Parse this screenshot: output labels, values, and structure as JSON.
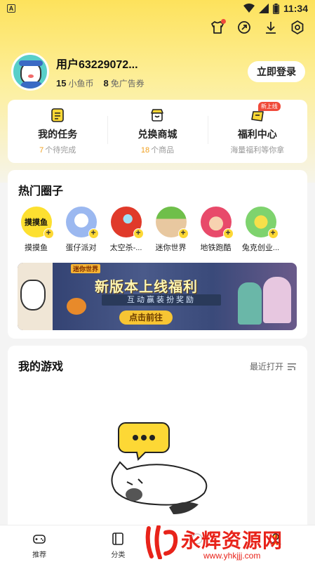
{
  "status_bar": {
    "time": "11:34",
    "app_badge": "A"
  },
  "top_icons": [
    {
      "icon": "shirt-icon"
    },
    {
      "icon": "refresh-icon"
    },
    {
      "icon": "download-icon"
    },
    {
      "icon": "settings-icon"
    }
  ],
  "profile": {
    "username": "用户63229072...",
    "coins_value": "15",
    "coins_label": "小鱼币",
    "coupons_value": "8",
    "coupons_label": "免广告券",
    "login_label": "立即登录"
  },
  "quick": [
    {
      "title": "我的任务",
      "highlight": "7",
      "sub": "个待完成",
      "icon": "task-icon"
    },
    {
      "title": "兑换商城",
      "highlight": "18",
      "sub": "个商品",
      "icon": "shop-icon"
    },
    {
      "title": "福利中心",
      "highlight": "",
      "sub": "海量福利等你拿",
      "icon": "gift-icon",
      "tag": "新上线"
    }
  ],
  "hot_circles": {
    "title": "热门圈子",
    "items": [
      {
        "name": "摸摸鱼",
        "logo_text": "摸摸鱼"
      },
      {
        "name": "蛋仔派对"
      },
      {
        "name": "太空杀-..."
      },
      {
        "name": "迷你世界"
      },
      {
        "name": "地铁跑酷"
      },
      {
        "name": "兔克创业..."
      }
    ]
  },
  "banner": {
    "tag": "迷你世界",
    "headline": "新版本上线福利",
    "subline": "互动赢装扮奖励",
    "button": "点击前往"
  },
  "my_games": {
    "title": "我的游戏",
    "recent_label": "最近打开"
  },
  "bottom_nav": [
    {
      "label": "推荐",
      "icon": "gamepad-icon"
    },
    {
      "label": "分类",
      "icon": "category-icon"
    },
    {
      "label": "",
      "icon": "center-icon"
    },
    {
      "label": "",
      "icon": "my-icon"
    }
  ],
  "watermark": {
    "text": "永辉资源网",
    "url": "www.yhkjjj.com"
  },
  "colors": {
    "accent": "#fdd835",
    "highlight": "#f0a020",
    "red": "#e8231a"
  }
}
